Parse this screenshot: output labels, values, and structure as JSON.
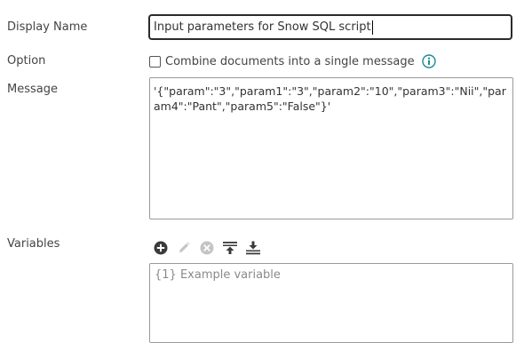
{
  "form": {
    "display_name": {
      "label": "Display Name",
      "value": "Input parameters for Snow SQL script"
    },
    "option": {
      "label": "Option",
      "checkbox_label": "Combine documents into a single message",
      "checked": false,
      "info_icon": "info-circle-icon"
    },
    "message": {
      "label": "Message",
      "value": "'{\"param\":\"3\",\"param1\":\"3\",\"param2\":\"10\",\"param3\":\"Nii\",\"param4\":\"Pant\",\"param5\":\"False\"}'"
    },
    "variables": {
      "label": "Variables",
      "toolbar": [
        "add-circle-icon",
        "edit-pencil-icon",
        "remove-circle-icon",
        "move-to-top-icon",
        "move-to-bottom-icon"
      ],
      "placeholder": "{1} Example variable"
    }
  },
  "colors": {
    "enabled_icon": "#3a3a3a",
    "disabled_icon": "#c4c4c4",
    "info_accent": "#1a8a94"
  }
}
